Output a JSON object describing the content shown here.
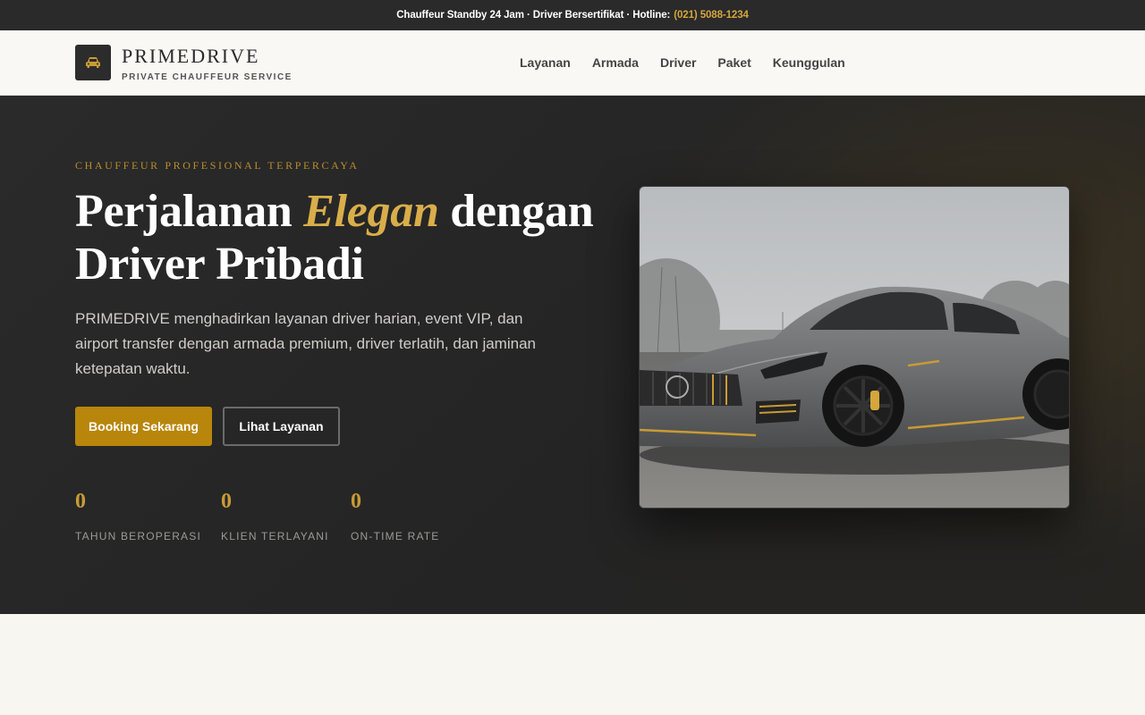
{
  "topbar": {
    "text": "Chauffeur Standby 24 Jam · Driver Bersertifikat · Hotline:",
    "hotline": "(021) 5088-1234"
  },
  "brand": {
    "name": "PRIMEDRIVE",
    "tagline": "PRIVATE CHAUFFEUR SERVICE",
    "icon": "car-icon"
  },
  "nav": {
    "items": [
      {
        "label": "Layanan"
      },
      {
        "label": "Armada"
      },
      {
        "label": "Driver"
      },
      {
        "label": "Paket"
      },
      {
        "label": "Keunggulan"
      }
    ]
  },
  "hero": {
    "eyebrow": "CHAUFFEUR PROFESIONAL TERPERCAYA",
    "title_before": "Perjalanan ",
    "title_accent": "Elegan",
    "title_after": " dengan Driver Pribadi",
    "lead": "PRIMEDRIVE menghadirkan layanan driver harian, event VIP, dan airport transfer dengan armada premium, driver terlatih, dan jaminan ketepatan waktu.",
    "primary_cta": "Booking Sekarang",
    "secondary_cta": "Lihat Layanan",
    "stats": [
      {
        "value": "0",
        "label": "TAHUN BEROPERASI"
      },
      {
        "value": "0",
        "label": "KLIEN TERLAYANI"
      },
      {
        "value": "0",
        "label": "ON-TIME RATE"
      }
    ]
  },
  "colors": {
    "accent": "#b8860b",
    "accent_light": "#d9ae4a",
    "dark": "#2a2a2a",
    "cream": "#f8f6f1"
  }
}
